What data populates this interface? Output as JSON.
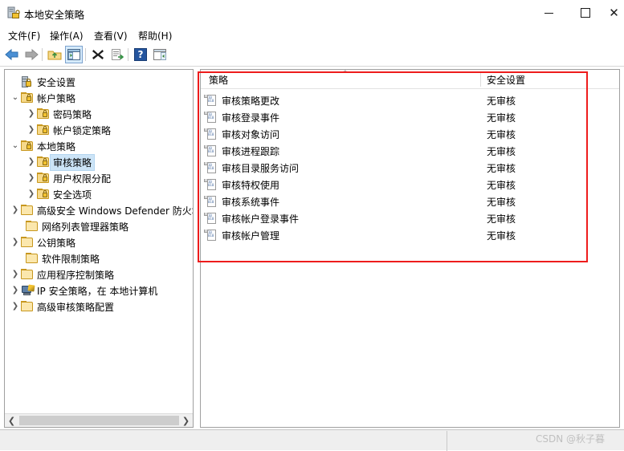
{
  "window": {
    "title": "本地安全策略",
    "icon": "security-policy-icon",
    "controls": {
      "minimize": "—",
      "maximize": "□",
      "close": "✕"
    }
  },
  "menubar": {
    "items": [
      {
        "label": "文件(F)",
        "name": "menu-file"
      },
      {
        "label": "操作(A)",
        "name": "menu-action"
      },
      {
        "label": "查看(V)",
        "name": "menu-view"
      },
      {
        "label": "帮助(H)",
        "name": "menu-help"
      }
    ]
  },
  "toolbar": {
    "items": [
      {
        "name": "back-icon",
        "label": "后退"
      },
      {
        "name": "forward-icon",
        "label": "前进"
      },
      {
        "name": "up-folder-icon",
        "label": "向上"
      },
      {
        "name": "show-console-tree-icon",
        "label": "显示/隐藏控制台树",
        "selected": true
      },
      {
        "name": "delete-icon",
        "label": "删除"
      },
      {
        "name": "export-list-icon",
        "label": "导出列表"
      },
      {
        "name": "help-icon",
        "label": "帮助"
      },
      {
        "name": "show-action-pane-icon",
        "label": "显示操作窗格"
      }
    ]
  },
  "tree": {
    "nodes": [
      {
        "label": "安全设置",
        "level": 0,
        "icon": "server-lock-icon",
        "twisty": "none",
        "selected": false
      },
      {
        "label": "帐户策略",
        "level": 1,
        "icon": "folder-lock-icon",
        "twisty": "expanded",
        "selected": false
      },
      {
        "label": "密码策略",
        "level": 2,
        "icon": "folder-lock-icon",
        "twisty": "collapsed",
        "selected": false
      },
      {
        "label": "帐户锁定策略",
        "level": 2,
        "icon": "folder-lock-icon",
        "twisty": "collapsed",
        "selected": false
      },
      {
        "label": "本地策略",
        "level": 1,
        "icon": "folder-lock-icon",
        "twisty": "expanded",
        "selected": false
      },
      {
        "label": "审核策略",
        "level": 2,
        "icon": "folder-lock-icon",
        "twisty": "collapsed",
        "selected": true
      },
      {
        "label": "用户权限分配",
        "level": 2,
        "icon": "folder-lock-icon",
        "twisty": "collapsed",
        "selected": false
      },
      {
        "label": "安全选项",
        "level": 2,
        "icon": "folder-lock-icon",
        "twisty": "collapsed",
        "selected": false
      },
      {
        "label": "高级安全 Windows Defender 防火墙",
        "level": 1,
        "icon": "folder-icon",
        "twisty": "collapsed",
        "selected": false
      },
      {
        "label": "网络列表管理器策略",
        "level": 1,
        "icon": "folder-icon",
        "twisty": "none",
        "selected": false
      },
      {
        "label": "公钥策略",
        "level": 1,
        "icon": "folder-icon",
        "twisty": "collapsed",
        "selected": false
      },
      {
        "label": "软件限制策略",
        "level": 1,
        "icon": "folder-icon",
        "twisty": "none",
        "selected": false
      },
      {
        "label": "应用程序控制策略",
        "level": 1,
        "icon": "folder-icon",
        "twisty": "collapsed",
        "selected": false
      },
      {
        "label": "IP 安全策略，在 本地计算机",
        "level": 1,
        "icon": "ip-security-icon",
        "twisty": "collapsed",
        "selected": false
      },
      {
        "label": "高级审核策略配置",
        "level": 1,
        "icon": "folder-icon",
        "twisty": "collapsed",
        "selected": false
      }
    ],
    "scrollbar": {
      "left_arrow": "❮",
      "right_arrow": "❯"
    }
  },
  "list": {
    "columns": [
      {
        "label": "策略",
        "name": "column-policy",
        "sorted": true,
        "sort_arrow": "^"
      },
      {
        "label": "安全设置",
        "name": "column-security-setting",
        "sorted": false
      }
    ],
    "rows": [
      {
        "policy": "审核策略更改",
        "setting": "无审核",
        "icon": "policy-doc-icon"
      },
      {
        "policy": "审核登录事件",
        "setting": "无审核",
        "icon": "policy-doc-icon"
      },
      {
        "policy": "审核对象访问",
        "setting": "无审核",
        "icon": "policy-doc-icon"
      },
      {
        "policy": "审核进程跟踪",
        "setting": "无审核",
        "icon": "policy-doc-icon"
      },
      {
        "policy": "审核目录服务访问",
        "setting": "无审核",
        "icon": "policy-doc-icon"
      },
      {
        "policy": "审核特权使用",
        "setting": "无审核",
        "icon": "policy-doc-icon"
      },
      {
        "policy": "审核系统事件",
        "setting": "无审核",
        "icon": "policy-doc-icon"
      },
      {
        "policy": "审核帐户登录事件",
        "setting": "无审核",
        "icon": "policy-doc-icon"
      },
      {
        "policy": "审核帐户管理",
        "setting": "无审核",
        "icon": "policy-doc-icon"
      }
    ]
  },
  "annotation": {
    "highlight_color": "#ee1c1c"
  },
  "watermark": {
    "text": "CSDN @秋子暮"
  }
}
